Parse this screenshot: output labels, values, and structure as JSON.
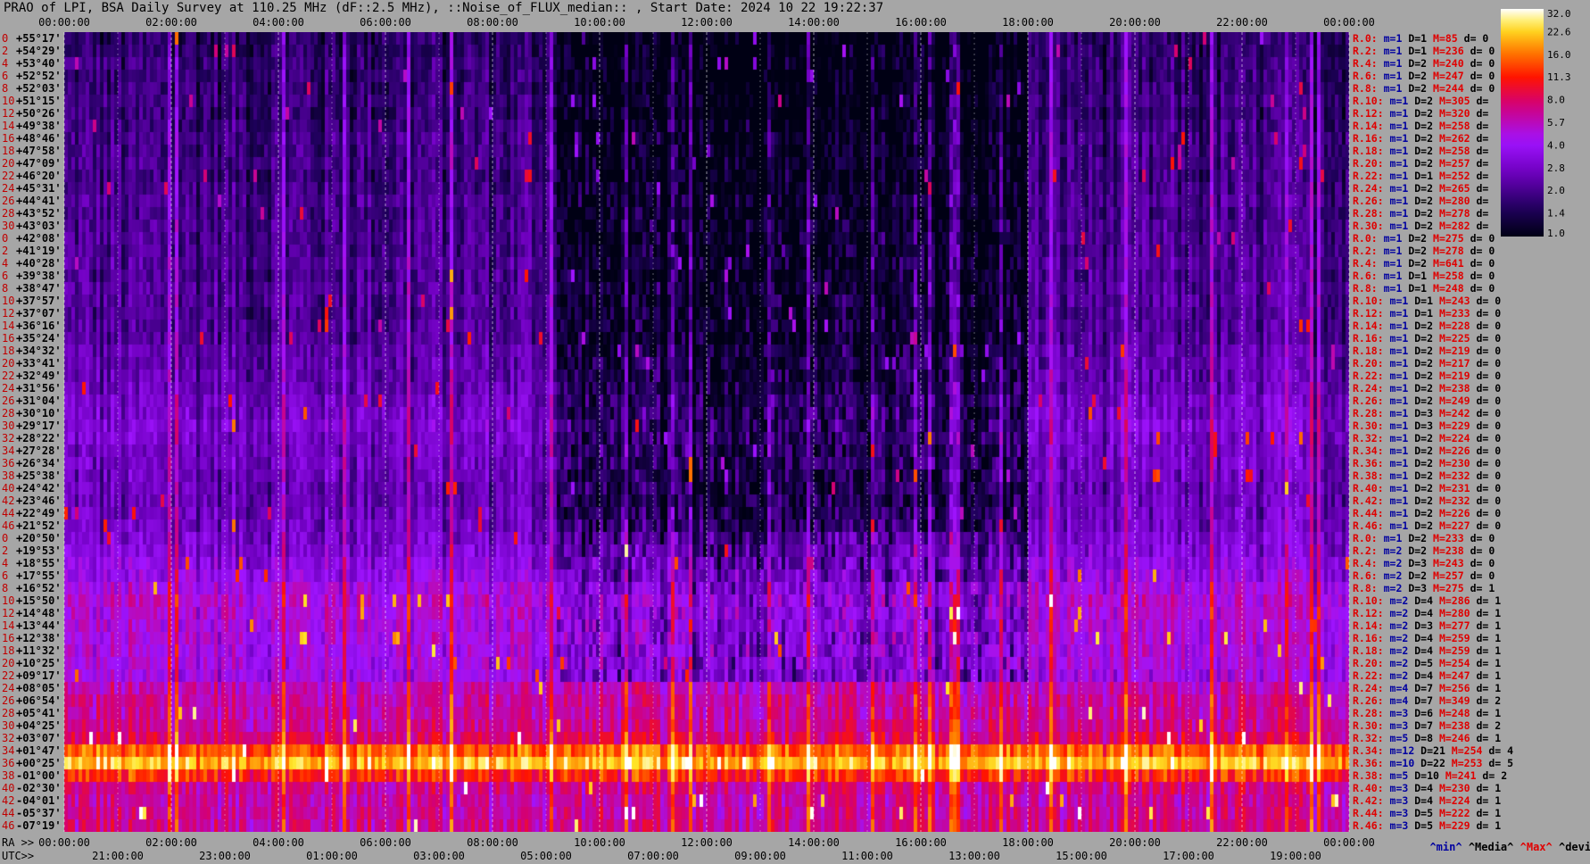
{
  "title": "PRAO of LPI, BSA Daily Survey at 110.25 MHz (dF::2.5 MHz), ::Noise_of_FLUX_median:: , Start Date: 2024 10 22 19:22:37",
  "colors": {
    "background": "#a6a6a6",
    "low": "#000018",
    "mid": "#9b00ff",
    "high": "#ff1a00",
    "max": "#ffffff",
    "red_label": "#e00000"
  },
  "chart_data": {
    "type": "heatmap",
    "title": "PRAO of LPI, BSA Daily Survey at 110.25 MHz (dF::2.5 MHz), ::Noise_of_FLUX_median:: , Start Date: 2024 10 22 19:22:37",
    "top_time_ticks": [
      "00:00:00",
      "02:00:00",
      "04:00:00",
      "06:00:00",
      "08:00:00",
      "10:00:00",
      "12:00:00",
      "14:00:00",
      "16:00:00",
      "18:00:00",
      "20:00:00",
      "22:00:00",
      "00:00:00"
    ],
    "ra_label": "RA >>",
    "ra_ticks": [
      "00:00:00",
      "02:00:00",
      "04:00:00",
      "06:00:00",
      "08:00:00",
      "10:00:00",
      "12:00:00",
      "14:00:00",
      "16:00:00",
      "18:00:00",
      "20:00:00",
      "22:00:00",
      "00:00:00"
    ],
    "utc_label": "UTC>>",
    "utc_ticks": [
      "21:00:00",
      "23:00:00",
      "01:00:00",
      "03:00:00",
      "05:00:00",
      "07:00:00",
      "09:00:00",
      "11:00:00",
      "13:00:00",
      "15:00:00",
      "17:00:00",
      "19:00:00"
    ],
    "declinations": [
      "+55°17'",
      "+54°29'",
      "+53°40'",
      "+52°52'",
      "+52°03'",
      "+51°15'",
      "+50°26'",
      "+49°38'",
      "+48°46'",
      "+47°58'",
      "+47°09'",
      "+46°20'",
      "+45°31'",
      "+44°41'",
      "+43°52'",
      "+43°03'",
      "+42°08'",
      "+41°19'",
      "+40°28'",
      "+39°38'",
      "+38°47'",
      "+37°57'",
      "+37°07'",
      "+36°16'",
      "+35°24'",
      "+34°32'",
      "+33°41'",
      "+32°49'",
      "+31°56'",
      "+31°04'",
      "+30°10'",
      "+29°17'",
      "+28°22'",
      "+27°28'",
      "+26°34'",
      "+25°38'",
      "+24°42'",
      "+23°46'",
      "+22°49'",
      "+21°52'",
      "+20°50'",
      "+19°53'",
      "+18°55'",
      "+17°55'",
      "+16°52'",
      "+15°50'",
      "+14°48'",
      "+13°44'",
      "+12°38'",
      "+11°32'",
      "+10°25'",
      "+09°17'",
      "+08°05'",
      "+06°54'",
      "+05°41'",
      "+04°25'",
      "+03°07'",
      "+01°47'",
      "+00°25'",
      "-01°00'",
      "-02°30'",
      "-04°01'",
      "-05°37'",
      "-07°19'"
    ],
    "row_indices": [
      "0",
      "2",
      "4",
      "6",
      "8",
      "10",
      "12",
      "14",
      "16",
      "18",
      "20",
      "22",
      "24",
      "26",
      "28",
      "30",
      "0",
      "2",
      "4",
      "6",
      "8",
      "10",
      "12",
      "14",
      "16",
      "18",
      "20",
      "22",
      "24",
      "26",
      "28",
      "30",
      "32",
      "34",
      "36",
      "38",
      "40",
      "42",
      "44",
      "46",
      "0",
      "2",
      "4",
      "6",
      "8",
      "10",
      "12",
      "14",
      "16",
      "18",
      "20",
      "22",
      "24",
      "26",
      "28",
      "30",
      "32",
      "34",
      "36",
      "38",
      "40",
      "42",
      "44",
      "46"
    ],
    "stats": [
      {
        "r": "R.0:",
        "m": "m=1",
        "D": "D=1",
        "M": "M=85",
        "d": "d= 0"
      },
      {
        "r": "R.2:",
        "m": "m=1",
        "D": "D=1",
        "M": "M=236",
        "d": "d= 0"
      },
      {
        "r": "R.4:",
        "m": "m=1",
        "D": "D=2",
        "M": "M=240",
        "d": "d= 0"
      },
      {
        "r": "R.6:",
        "m": "m=1",
        "D": "D=2",
        "M": "M=247",
        "d": "d= 0"
      },
      {
        "r": "R.8:",
        "m": "m=1",
        "D": "D=2",
        "M": "M=244",
        "d": "d= 0"
      },
      {
        "r": "R.10:",
        "m": "m=1",
        "D": "D=2",
        "M": "M=305",
        "d": "d="
      },
      {
        "r": "R.12:",
        "m": "m=1",
        "D": "D=2",
        "M": "M=320",
        "d": "d="
      },
      {
        "r": "R.14:",
        "m": "m=1",
        "D": "D=2",
        "M": "M=258",
        "d": "d="
      },
      {
        "r": "R.16:",
        "m": "m=1",
        "D": "D=2",
        "M": "M=262",
        "d": "d="
      },
      {
        "r": "R.18:",
        "m": "m=1",
        "D": "D=2",
        "M": "M=258",
        "d": "d="
      },
      {
        "r": "R.20:",
        "m": "m=1",
        "D": "D=2",
        "M": "M=257",
        "d": "d="
      },
      {
        "r": "R.22:",
        "m": "m=1",
        "D": "D=1",
        "M": "M=252",
        "d": "d="
      },
      {
        "r": "R.24:",
        "m": "m=1",
        "D": "D=2",
        "M": "M=265",
        "d": "d="
      },
      {
        "r": "R.26:",
        "m": "m=1",
        "D": "D=2",
        "M": "M=280",
        "d": "d="
      },
      {
        "r": "R.28:",
        "m": "m=1",
        "D": "D=2",
        "M": "M=278",
        "d": "d="
      },
      {
        "r": "R.30:",
        "m": "m=1",
        "D": "D=2",
        "M": "M=282",
        "d": "d="
      },
      {
        "r": "R.0:",
        "m": "m=1",
        "D": "D=2",
        "M": "M=275",
        "d": "d= 0"
      },
      {
        "r": "R.2:",
        "m": "m=1",
        "D": "D=2",
        "M": "M=278",
        "d": "d= 0"
      },
      {
        "r": "R.4:",
        "m": "m=1",
        "D": "D=2",
        "M": "M=641",
        "d": "d= 0"
      },
      {
        "r": "R.6:",
        "m": "m=1",
        "D": "D=1",
        "M": "M=258",
        "d": "d= 0"
      },
      {
        "r": "R.8:",
        "m": "m=1",
        "D": "D=1",
        "M": "M=248",
        "d": "d= 0"
      },
      {
        "r": "R.10:",
        "m": "m=1",
        "D": "D=1",
        "M": "M=243",
        "d": "d= 0"
      },
      {
        "r": "R.12:",
        "m": "m=1",
        "D": "D=1",
        "M": "M=233",
        "d": "d= 0"
      },
      {
        "r": "R.14:",
        "m": "m=1",
        "D": "D=2",
        "M": "M=228",
        "d": "d= 0"
      },
      {
        "r": "R.16:",
        "m": "m=1",
        "D": "D=2",
        "M": "M=225",
        "d": "d= 0"
      },
      {
        "r": "R.18:",
        "m": "m=1",
        "D": "D=2",
        "M": "M=219",
        "d": "d= 0"
      },
      {
        "r": "R.20:",
        "m": "m=1",
        "D": "D=2",
        "M": "M=217",
        "d": "d= 0"
      },
      {
        "r": "R.22:",
        "m": "m=1",
        "D": "D=2",
        "M": "M=219",
        "d": "d= 0"
      },
      {
        "r": "R.24:",
        "m": "m=1",
        "D": "D=2",
        "M": "M=238",
        "d": "d= 0"
      },
      {
        "r": "R.26:",
        "m": "m=1",
        "D": "D=2",
        "M": "M=249",
        "d": "d= 0"
      },
      {
        "r": "R.28:",
        "m": "m=1",
        "D": "D=3",
        "M": "M=242",
        "d": "d= 0"
      },
      {
        "r": "R.30:",
        "m": "m=1",
        "D": "D=3",
        "M": "M=229",
        "d": "d= 0"
      },
      {
        "r": "R.32:",
        "m": "m=1",
        "D": "D=2",
        "M": "M=224",
        "d": "d= 0"
      },
      {
        "r": "R.34:",
        "m": "m=1",
        "D": "D=2",
        "M": "M=226",
        "d": "d= 0"
      },
      {
        "r": "R.36:",
        "m": "m=1",
        "D": "D=2",
        "M": "M=230",
        "d": "d= 0"
      },
      {
        "r": "R.38:",
        "m": "m=1",
        "D": "D=2",
        "M": "M=232",
        "d": "d= 0"
      },
      {
        "r": "R.40:",
        "m": "m=1",
        "D": "D=2",
        "M": "M=231",
        "d": "d= 0"
      },
      {
        "r": "R.42:",
        "m": "m=1",
        "D": "D=2",
        "M": "M=232",
        "d": "d= 0"
      },
      {
        "r": "R.44:",
        "m": "m=1",
        "D": "D=2",
        "M": "M=226",
        "d": "d= 0"
      },
      {
        "r": "R.46:",
        "m": "m=1",
        "D": "D=2",
        "M": "M=227",
        "d": "d= 0"
      },
      {
        "r": "R.0:",
        "m": "m=1",
        "D": "D=2",
        "M": "M=233",
        "d": "d= 0"
      },
      {
        "r": "R.2:",
        "m": "m=2",
        "D": "D=2",
        "M": "M=238",
        "d": "d= 0"
      },
      {
        "r": "R.4:",
        "m": "m=2",
        "D": "D=3",
        "M": "M=243",
        "d": "d= 0"
      },
      {
        "r": "R.6:",
        "m": "m=2",
        "D": "D=2",
        "M": "M=257",
        "d": "d= 0"
      },
      {
        "r": "R.8:",
        "m": "m=2",
        "D": "D=3",
        "M": "M=275",
        "d": "d= 1"
      },
      {
        "r": "R.10:",
        "m": "m=2",
        "D": "D=4",
        "M": "M=286",
        "d": "d= 1"
      },
      {
        "r": "R.12:",
        "m": "m=2",
        "D": "D=4",
        "M": "M=280",
        "d": "d= 1"
      },
      {
        "r": "R.14:",
        "m": "m=2",
        "D": "D=3",
        "M": "M=277",
        "d": "d= 1"
      },
      {
        "r": "R.16:",
        "m": "m=2",
        "D": "D=4",
        "M": "M=259",
        "d": "d= 1"
      },
      {
        "r": "R.18:",
        "m": "m=2",
        "D": "D=4",
        "M": "M=259",
        "d": "d= 1"
      },
      {
        "r": "R.20:",
        "m": "m=2",
        "D": "D=5",
        "M": "M=254",
        "d": "d= 1"
      },
      {
        "r": "R.22:",
        "m": "m=2",
        "D": "D=4",
        "M": "M=247",
        "d": "d= 1"
      },
      {
        "r": "R.24:",
        "m": "m=4",
        "D": "D=7",
        "M": "M=256",
        "d": "d= 1"
      },
      {
        "r": "R.26:",
        "m": "m=4",
        "D": "D=7",
        "M": "M=349",
        "d": "d= 2"
      },
      {
        "r": "R.28:",
        "m": "m=3",
        "D": "D=6",
        "M": "M=248",
        "d": "d= 1"
      },
      {
        "r": "R.30:",
        "m": "m=3",
        "D": "D=7",
        "M": "M=238",
        "d": "d= 2"
      },
      {
        "r": "R.32:",
        "m": "m=5",
        "D": "D=8",
        "M": "M=246",
        "d": "d= 1"
      },
      {
        "r": "R.34:",
        "m": "m=12",
        "D": "D=21",
        "M": "M=254",
        "d": "d= 4"
      },
      {
        "r": "R.36:",
        "m": "m=10",
        "D": "D=22",
        "M": "M=253",
        "d": "d= 5"
      },
      {
        "r": "R.38:",
        "m": "m=5",
        "D": "D=10",
        "M": "M=241",
        "d": "d= 2"
      },
      {
        "r": "R.40:",
        "m": "m=3",
        "D": "D=4",
        "M": "M=230",
        "d": "d= 1"
      },
      {
        "r": "R.42:",
        "m": "m=3",
        "D": "D=4",
        "M": "M=224",
        "d": "d= 1"
      },
      {
        "r": "R.44:",
        "m": "m=3",
        "D": "D=5",
        "M": "M=222",
        "d": "d= 1"
      },
      {
        "r": "R.46:",
        "m": "m=3",
        "D": "D=5",
        "M": "M=229",
        "d": "d= 1"
      }
    ],
    "legend": {
      "min": "^min^",
      "media": "^Media^",
      "max": "^Max^",
      "devia": "^devia^"
    },
    "colorbar": {
      "ticks": [
        "32.0",
        "22.6",
        "16.0",
        "11.3",
        "8.0",
        "5.7",
        "4.0",
        "2.8",
        "2.0",
        "1.4",
        "1.0"
      ],
      "range": [
        1.0,
        32.0
      ],
      "scale": "log2"
    },
    "n_rows": 64,
    "n_time": 360,
    "row_base_level": [
      1.5,
      1.5,
      1.6,
      1.6,
      1.6,
      1.7,
      1.6,
      1.7,
      1.8,
      1.8,
      1.8,
      1.7,
      1.8,
      1.9,
      1.8,
      1.9,
      1.9,
      1.9,
      2.0,
      1.9,
      2.0,
      2.0,
      1.9,
      2.0,
      2.0,
      2.2,
      2.2,
      2.3,
      2.4,
      2.6,
      2.7,
      2.9,
      2.7,
      2.6,
      2.6,
      2.5,
      2.4,
      2.4,
      2.5,
      2.6,
      2.8,
      3.0,
      3.3,
      3.6,
      4.2,
      4.8,
      4.6,
      4.4,
      4.4,
      4.3,
      4.2,
      4.0,
      5.5,
      6.0,
      6.0,
      6.4,
      7.5,
      14,
      20,
      11,
      6.5,
      6.0,
      6.2,
      6.5
    ],
    "quiet_window_hours": [
      9.2,
      18.0
    ]
  }
}
